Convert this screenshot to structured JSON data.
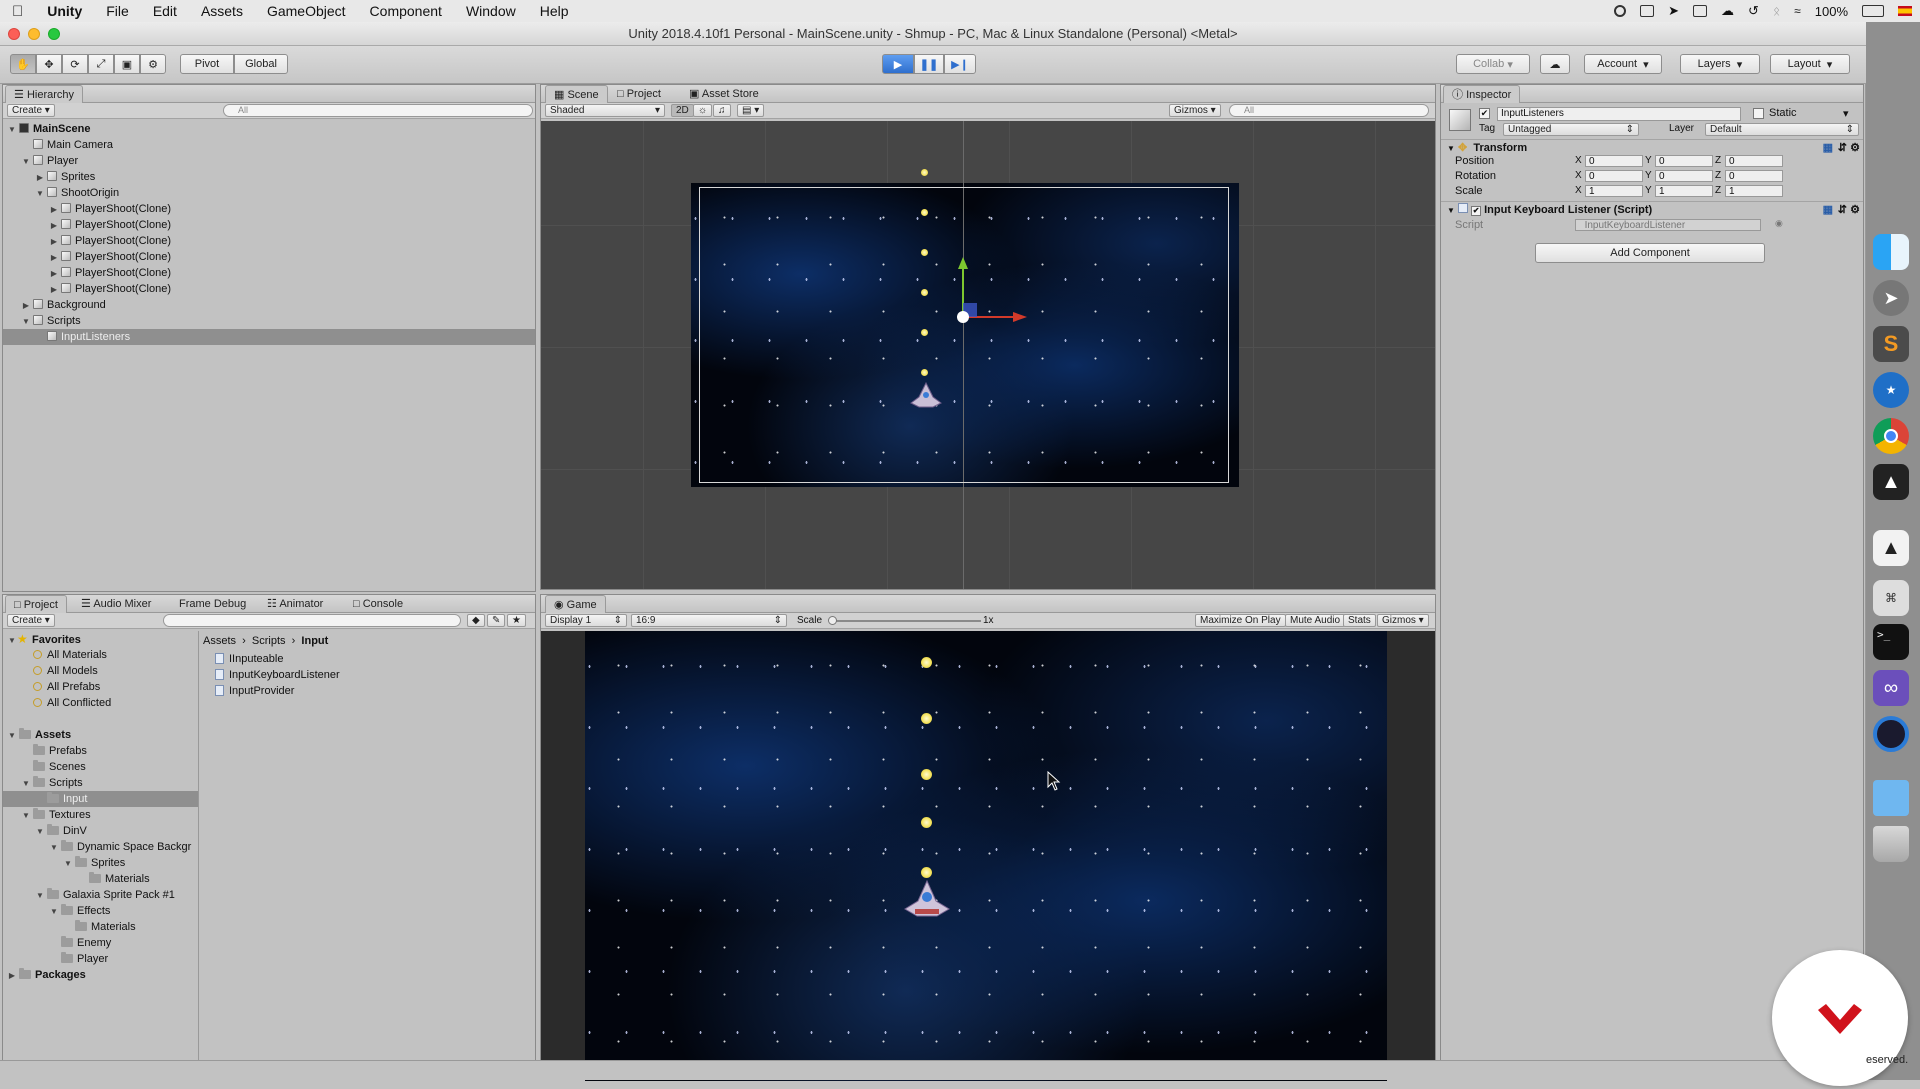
{
  "menubar": {
    "apple": "",
    "items": [
      "Unity",
      "File",
      "Edit",
      "Assets",
      "GameObject",
      "Component",
      "Window",
      "Help"
    ],
    "battery": "100%"
  },
  "window": {
    "title": "Unity 2018.4.10f1 Personal - MainScene.unity - Shmup - PC, Mac & Linux Standalone (Personal) <Metal>"
  },
  "toolbar": {
    "pivot": "Pivot",
    "global": "Global",
    "collab": "Collab",
    "account": "Account",
    "layers": "Layers",
    "layout": "Layout"
  },
  "hierarchy": {
    "tab": "Hierarchy",
    "create": "Create",
    "search_placeholder": "All",
    "rows": [
      {
        "label": "MainScene",
        "indent": 0,
        "arrow": "▼",
        "icon": "unity",
        "bold": true
      },
      {
        "label": "Main Camera",
        "indent": 1,
        "arrow": "",
        "icon": "cube"
      },
      {
        "label": "Player",
        "indent": 1,
        "arrow": "▼",
        "icon": "cube"
      },
      {
        "label": "Sprites",
        "indent": 2,
        "arrow": "▶",
        "icon": "cube"
      },
      {
        "label": "ShootOrigin",
        "indent": 2,
        "arrow": "▼",
        "icon": "cube"
      },
      {
        "label": "PlayerShoot(Clone)",
        "indent": 3,
        "arrow": "▶",
        "icon": "cube"
      },
      {
        "label": "PlayerShoot(Clone)",
        "indent": 3,
        "arrow": "▶",
        "icon": "cube"
      },
      {
        "label": "PlayerShoot(Clone)",
        "indent": 3,
        "arrow": "▶",
        "icon": "cube"
      },
      {
        "label": "PlayerShoot(Clone)",
        "indent": 3,
        "arrow": "▶",
        "icon": "cube"
      },
      {
        "label": "PlayerShoot(Clone)",
        "indent": 3,
        "arrow": "▶",
        "icon": "cube"
      },
      {
        "label": "PlayerShoot(Clone)",
        "indent": 3,
        "arrow": "▶",
        "icon": "cube"
      },
      {
        "label": "Background",
        "indent": 1,
        "arrow": "▶",
        "icon": "cube"
      },
      {
        "label": "Scripts",
        "indent": 1,
        "arrow": "▼",
        "icon": "cube"
      },
      {
        "label": "InputListeners",
        "indent": 2,
        "arrow": "",
        "icon": "cube",
        "selected": true
      }
    ]
  },
  "scene": {
    "tabs": [
      "Scene",
      "Project",
      "Asset Store"
    ],
    "shading": "Shaded",
    "mode_2d": "2D",
    "gizmos": "Gizmos",
    "search_placeholder": "All"
  },
  "project": {
    "tabs": [
      "Project",
      "Audio Mixer",
      "Frame Debug",
      "Animator",
      "Console"
    ],
    "create": "Create",
    "tree": [
      {
        "label": "Favorites",
        "indent": 0,
        "arrow": "▼",
        "icon": "star",
        "bold": true
      },
      {
        "label": "All Materials",
        "indent": 1,
        "arrow": "",
        "icon": "mag"
      },
      {
        "label": "All Models",
        "indent": 1,
        "arrow": "",
        "icon": "mag"
      },
      {
        "label": "All Prefabs",
        "indent": 1,
        "arrow": "",
        "icon": "mag"
      },
      {
        "label": "All Conflicted",
        "indent": 1,
        "arrow": "",
        "icon": "mag"
      },
      {
        "label": "",
        "indent": 0,
        "arrow": "",
        "icon": "none"
      },
      {
        "label": "Assets",
        "indent": 0,
        "arrow": "▼",
        "icon": "folder",
        "bold": true
      },
      {
        "label": "Prefabs",
        "indent": 1,
        "arrow": "",
        "icon": "folder"
      },
      {
        "label": "Scenes",
        "indent": 1,
        "arrow": "",
        "icon": "folder"
      },
      {
        "label": "Scripts",
        "indent": 1,
        "arrow": "▼",
        "icon": "folder"
      },
      {
        "label": "Input",
        "indent": 2,
        "arrow": "",
        "icon": "folder",
        "selected": true
      },
      {
        "label": "Textures",
        "indent": 1,
        "arrow": "▼",
        "icon": "folder"
      },
      {
        "label": "DinV",
        "indent": 2,
        "arrow": "▼",
        "icon": "folder"
      },
      {
        "label": "Dynamic Space Backgr",
        "indent": 3,
        "arrow": "▼",
        "icon": "folder"
      },
      {
        "label": "Sprites",
        "indent": 4,
        "arrow": "▼",
        "icon": "folder"
      },
      {
        "label": "Materials",
        "indent": 5,
        "arrow": "",
        "icon": "folder"
      },
      {
        "label": "Galaxia Sprite Pack #1",
        "indent": 2,
        "arrow": "▼",
        "icon": "folder"
      },
      {
        "label": "Effects",
        "indent": 3,
        "arrow": "▼",
        "icon": "folder"
      },
      {
        "label": "Materials",
        "indent": 4,
        "arrow": "",
        "icon": "folder"
      },
      {
        "label": "Enemy",
        "indent": 3,
        "arrow": "",
        "icon": "folder"
      },
      {
        "label": "Player",
        "indent": 3,
        "arrow": "",
        "icon": "folder"
      },
      {
        "label": "Packages",
        "indent": 0,
        "arrow": "▶",
        "icon": "folder",
        "bold": true
      }
    ],
    "breadcrumb": [
      "Assets",
      "Scripts",
      "Input"
    ],
    "files": [
      "IInputeable",
      "InputKeyboardListener",
      "InputProvider"
    ]
  },
  "game": {
    "tab": "Game",
    "display": "Display 1",
    "aspect": "16:9",
    "scale_label": "Scale",
    "scale_value": "1x",
    "maximize": "Maximize On Play",
    "mute": "Mute Audio",
    "stats": "Stats",
    "gizmos": "Gizmos"
  },
  "inspector": {
    "tab": "Inspector",
    "object_name": "InputListeners",
    "static_label": "Static",
    "tag_label": "Tag",
    "tag_value": "Untagged",
    "layer_label": "Layer",
    "layer_value": "Default",
    "transform": {
      "title": "Transform",
      "rows": [
        {
          "label": "Position",
          "x": "0",
          "y": "0",
          "z": "0"
        },
        {
          "label": "Rotation",
          "x": "0",
          "y": "0",
          "z": "0"
        },
        {
          "label": "Scale",
          "x": "1",
          "y": "1",
          "z": "1"
        }
      ]
    },
    "component": {
      "title": "Input Keyboard Listener (Script)",
      "script_label": "Script",
      "script_value": "InputKeyboardListener"
    },
    "add_component": "Add Component"
  },
  "footer": {
    "reserved": "eserved."
  },
  "colors": {
    "play_active": "#3b7dd8",
    "selection": "#8f8f8f",
    "logo_red": "#d0121b"
  }
}
